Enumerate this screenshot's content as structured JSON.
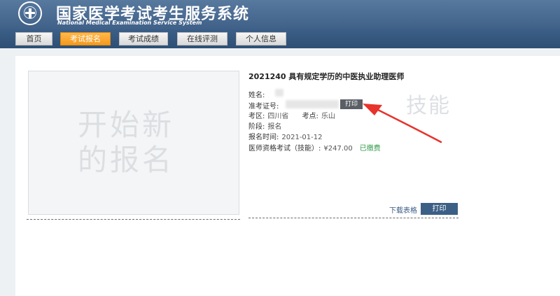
{
  "header": {
    "title": "国家医学考试考生服务系统",
    "subtitle": "National Medical Examination Service System"
  },
  "nav": {
    "items": [
      {
        "label": "首页",
        "active": false
      },
      {
        "label": "考试报名",
        "active": true
      },
      {
        "label": "考试成绩",
        "active": false
      },
      {
        "label": "在线评测",
        "active": false
      },
      {
        "label": "个人信息",
        "active": false
      }
    ]
  },
  "photo": {
    "watermark_line1": "开始新",
    "watermark_line2": "的报名"
  },
  "exam": {
    "title": "2021240 具有规定学历的中医执业助理医师",
    "name_label": "姓名:",
    "ticket_label": "准考证号:",
    "print_small_label": "打印",
    "region_label": "考区:",
    "region_value": "四川省",
    "site_label": "考点:",
    "site_value": "乐山",
    "stage_label": "阶段:",
    "stage_value": "报名",
    "time_label": "报名时间:",
    "time_value": "2021-01-12",
    "fee_label": "医师资格考试（技能）:",
    "fee_value": "¥247.00",
    "fee_status": "已缴费",
    "skill_watermark": "技能"
  },
  "actions": {
    "download_label": "下载表格",
    "print_label": "打印"
  },
  "colors": {
    "header_blue": "#4a6a92",
    "active_orange": "#f59a1c",
    "paid_green": "#2f9a45",
    "arrow_red": "#e8322c"
  }
}
